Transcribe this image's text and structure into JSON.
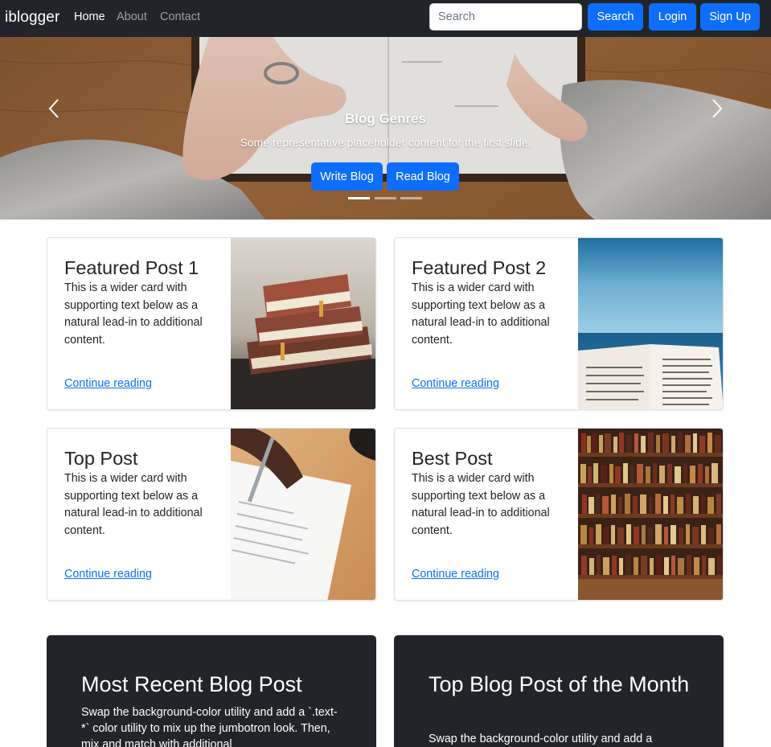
{
  "navbar": {
    "brand": "iblogger",
    "links": [
      "Home",
      "About",
      "Contact"
    ],
    "search_placeholder": "Search",
    "search_button": "Search",
    "login_button": "Login",
    "signup_button": "Sign Up"
  },
  "carousel": {
    "title": "Blog Genres",
    "text": "Some representative placeholder content for the first slide.",
    "write_button": "Write Blog",
    "read_button": "Read Blog",
    "slide_count": 3,
    "active_slide": 1
  },
  "cards": [
    {
      "title": "Featured Post 1",
      "text": "This is a wider card with supporting text below as a natural lead-in to additional content.",
      "link": "Continue reading",
      "image": "stacked-books-photo"
    },
    {
      "title": "Featured Post 2",
      "text": "This is a wider card with supporting text below as a natural lead-in to additional content.",
      "link": "Continue reading",
      "image": "open-book-by-sea-photo"
    },
    {
      "title": "Top Post",
      "text": "This is a wider card with supporting text below as a natural lead-in to additional content.",
      "link": "Continue reading",
      "image": "hand-writing-with-pen-photo"
    },
    {
      "title": "Best Post",
      "text": "This is a wider card with supporting text below as a natural lead-in to additional content.",
      "link": "Continue reading",
      "image": "bookshelf-photo"
    }
  ],
  "jumbotrons": [
    {
      "title": "Most Recent Blog Post",
      "text": "Swap the background-color utility and add a `.text-*` color utility to mix up the jumbotron look. Then, mix and match with additional"
    },
    {
      "title": "Top Blog Post of the Month",
      "text": "Swap the background-color utility and add a"
    }
  ],
  "colors": {
    "navbar": "#212529",
    "primary": "#0d6efd",
    "jumbotron": "#212529"
  }
}
